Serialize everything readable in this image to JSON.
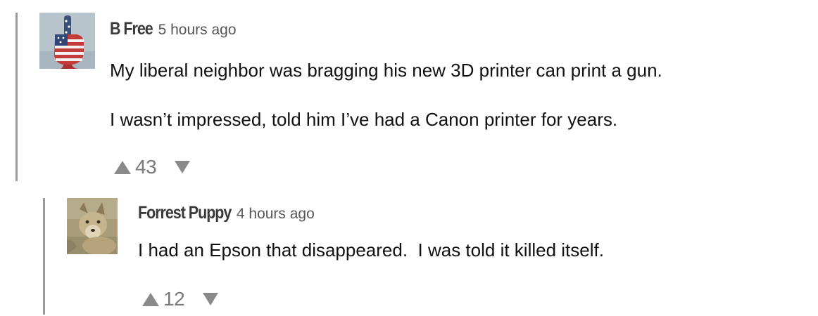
{
  "comments": [
    {
      "author": "B Free",
      "time": "5 hours ago",
      "avatar_icon": "flag-fist-avatar",
      "paragraphs": [
        "My liberal neighbor was bragging his new 3D printer can print a gun.",
        "I wasn’t impressed, told him I’ve had a Canon printer for years."
      ],
      "votes": "43",
      "upvote_icon": "triangle-up-icon",
      "downvote_icon": "triangle-down-icon"
    },
    {
      "author": "Forrest Puppy",
      "time": "4 hours ago",
      "avatar_icon": "coyote-avatar",
      "paragraphs": [
        "I had an Epson that disappeared.  I was told it killed itself."
      ],
      "votes": "12",
      "upvote_icon": "triangle-up-icon",
      "downvote_icon": "triangle-down-icon"
    }
  ],
  "colors": {
    "rail": "#9a9a9a",
    "author": "#3a3a3a",
    "timestamp": "#555555",
    "body_text": "#111111",
    "vote": "#8a8a8a"
  }
}
